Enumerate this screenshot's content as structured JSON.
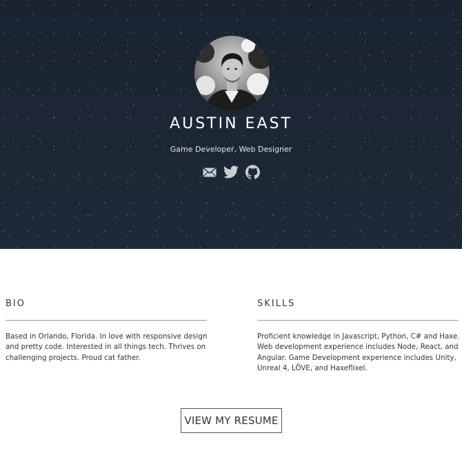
{
  "hero": {
    "name": "AUSTIN EAST",
    "tagline": "Game Developer, Web Designer",
    "socials": [
      {
        "icon": "email-icon"
      },
      {
        "icon": "twitter-icon"
      },
      {
        "icon": "github-icon"
      }
    ],
    "background_color": "#1c2633"
  },
  "bio": {
    "heading": "BIO",
    "text": "Based in Orlando, Florida. In love with responsive design and pretty code. Interested in all things tech. Thrives on challenging projects. Proud cat father."
  },
  "skills": {
    "heading": "SKILLS",
    "text": "Proficient knowledge in Javascript, Python, C# and Haxe. Web development experience includes Node, React, and Angular. Game Development experience includes Unity, Unreal 4, LÖVE, and Haxeflixel."
  },
  "resume_button": {
    "label": "VIEW MY RESUME"
  }
}
